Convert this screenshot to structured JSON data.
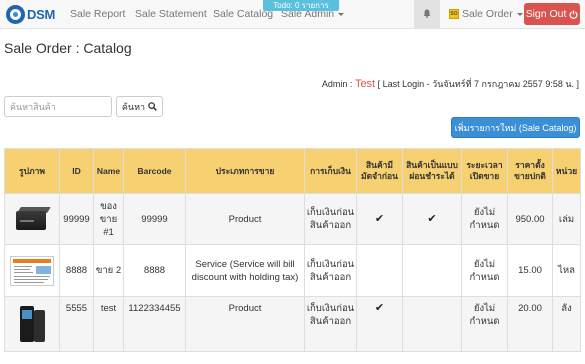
{
  "brand": {
    "name": "DSM"
  },
  "nav": {
    "items": [
      "Sale Report",
      "Sale Statement",
      "Sale Catalog",
      "Sale Admin"
    ],
    "todo_badge": "Todo: 0 รายการ",
    "sale_order_label": "Sale Order",
    "signout_label": "Sign Out",
    "icons": {
      "notify": "bell-icon",
      "signout": "power-icon",
      "sale_order": "so-icon"
    }
  },
  "page": {
    "title": "Sale Order : Catalog",
    "admin_prefix": "Admin : ",
    "admin_name": "Test",
    "last_login": "[ Last Login - วันจันทร์ที่ 7 กรกฎาคม 2557 9:58 น. ]"
  },
  "search": {
    "placeholder": "ค้นหาสินค้า",
    "button_label": "ค้นหา"
  },
  "actions": {
    "add_label": "เพิ่มรายการใหม่ (Sale Catalog)"
  },
  "colors": {
    "header_bg": "#f7d171",
    "primary": "#3a8fd6",
    "danger": "#d9534f"
  },
  "table": {
    "headers": [
      "รูปภาพ",
      "ID",
      "Name",
      "Barcode",
      "ประเภทการขาย",
      "การเก็บเงิน",
      "สินค้ามีมัดจำก่อน",
      "สินค้าเป็นแบบผ่อนชำระได้",
      "ระยะเวลาเปิดขาย",
      "ราคาตั้งขายปกติ",
      "หน่วย"
    ],
    "rows": [
      {
        "image": "product-box-image",
        "id": "99999",
        "name": "ของขาย #1",
        "barcode": "99999",
        "type": "Product",
        "payment": "เก็บเงินก่อนสินค้าออก",
        "deposit": true,
        "installment": true,
        "period": "ยังไม่กำหนด",
        "price": "950.00",
        "unit": "เล่ม"
      },
      {
        "image": "service-doc-image",
        "id": "8888",
        "name": "ขาย 2",
        "barcode": "8888",
        "type": "Service (Service will bill discount with holding tax)",
        "payment": "เก็บเงินก่อนสินค้าออก",
        "deposit": false,
        "installment": false,
        "period": "ยังไม่กำหนด",
        "price": "15.00",
        "unit": "ไหล"
      },
      {
        "image": "device-image",
        "id": "5555",
        "name": "test",
        "barcode": "1122334455",
        "type": "Product",
        "payment": "เก็บเงินก่อนสินค้าออก",
        "deposit": true,
        "installment": false,
        "period": "ยังไม่กำหนด",
        "price": "20.00",
        "unit": "ลัง"
      }
    ]
  }
}
